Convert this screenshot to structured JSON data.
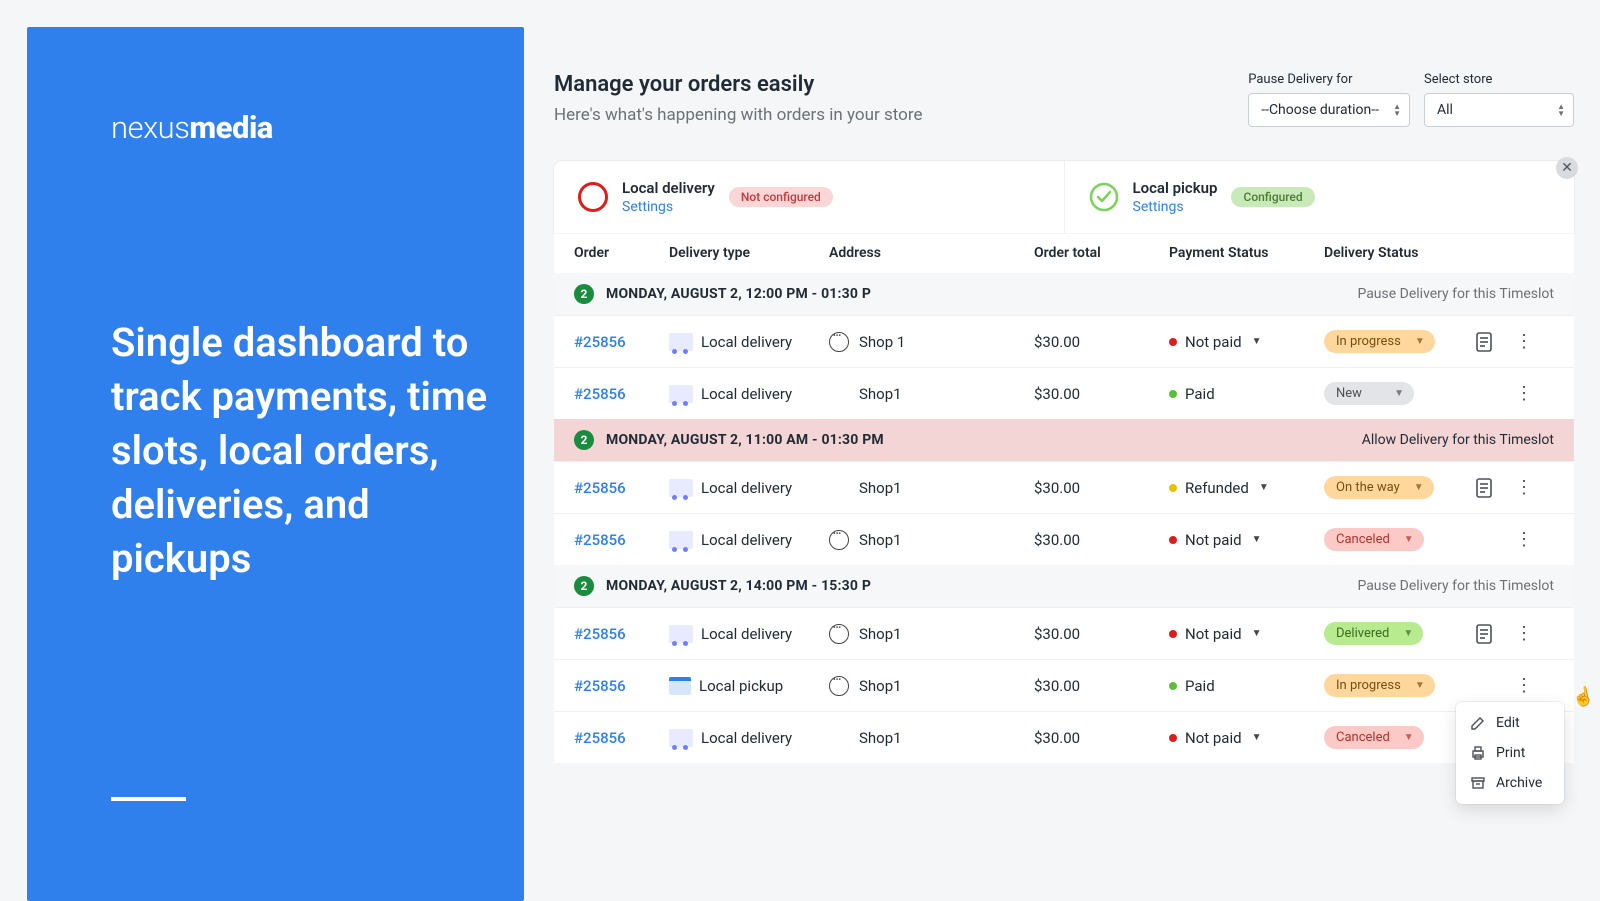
{
  "brand": {
    "light": "nexus",
    "bold": "media"
  },
  "headline": "Single dashboard to track payments, time slots, local orders, deliveries, and pickups",
  "header": {
    "title": "Manage your orders easily",
    "subtitle": "Here's what's happening with orders in your store"
  },
  "selects": {
    "pause_label": "Pause Delivery for",
    "pause_value": "--Choose duration--",
    "store_label": "Select store",
    "store_value": "All"
  },
  "config": {
    "delivery": {
      "title": "Local delivery",
      "link": "Settings",
      "badge": "Not configured"
    },
    "pickup": {
      "title": "Local pickup",
      "link": "Settings",
      "badge": "Configured"
    }
  },
  "columns": {
    "order": "Order",
    "delivery_type": "Delivery type",
    "address": "Address",
    "order_total": "Order total",
    "payment_status": "Payment Status",
    "delivery_status": "Delivery Status"
  },
  "popover": {
    "edit": "Edit",
    "print": "Print",
    "archive": "Archive"
  },
  "groups": [
    {
      "count": "2",
      "label": "MONDAY, AUGUST 2, 12:00 PM - 01:30 P",
      "action": "Pause Delivery for this Timeslot",
      "paused": false,
      "rows": [
        {
          "order": "#25856",
          "type": "Local delivery",
          "type_icon": "truck",
          "address": "Shop 1",
          "bubble": true,
          "total": "$30.00",
          "pay": "Not paid",
          "pay_dot": "red",
          "pay_caret": true,
          "status": "In progress",
          "status_class": "pill-yellow",
          "doc": true
        },
        {
          "order": "#25856",
          "type": "Local delivery",
          "type_icon": "truck",
          "address": "Shop1",
          "bubble": false,
          "total": "$30.00",
          "pay": "Paid",
          "pay_dot": "green",
          "pay_caret": false,
          "status": "New",
          "status_class": "pill-gray",
          "doc": false
        }
      ]
    },
    {
      "count": "2",
      "label": "MONDAY, AUGUST 2, 11:00 AM - 01:30 PM",
      "action": "Allow Delivery for this Timeslot",
      "paused": true,
      "rows": [
        {
          "order": "#25856",
          "type": "Local delivery",
          "type_icon": "truck",
          "address": "Shop1",
          "bubble": false,
          "total": "$30.00",
          "pay": "Refunded",
          "pay_dot": "yellow",
          "pay_caret": true,
          "status": "On the way",
          "status_class": "pill-yellow",
          "doc": true
        },
        {
          "order": "#25856",
          "type": "Local delivery",
          "type_icon": "truck",
          "address": "Shop1",
          "bubble": true,
          "total": "$30.00",
          "pay": "Not paid",
          "pay_dot": "red",
          "pay_caret": true,
          "status": "Canceled",
          "status_class": "pill-rose",
          "doc": false
        }
      ]
    },
    {
      "count": "2",
      "label": "MONDAY, AUGUST 2, 14:00 PM - 15:30 P",
      "action": "Pause Delivery for this Timeslot",
      "paused": false,
      "rows": [
        {
          "order": "#25856",
          "type": "Local delivery",
          "type_icon": "truck",
          "address": "Shop1",
          "bubble": true,
          "total": "$30.00",
          "pay": "Not paid",
          "pay_dot": "red",
          "pay_caret": true,
          "status": "Delivered",
          "status_class": "pill-lime",
          "doc": true
        },
        {
          "order": "#25856",
          "type": "Local pickup",
          "type_icon": "store",
          "address": "Shop1",
          "bubble": true,
          "total": "$30.00",
          "pay": "Paid",
          "pay_dot": "green",
          "pay_caret": false,
          "status": "In progress",
          "status_class": "pill-yellow",
          "doc": false
        },
        {
          "order": "#25856",
          "type": "Local delivery",
          "type_icon": "truck",
          "address": "Shop1",
          "bubble": false,
          "total": "$30.00",
          "pay": "Not paid",
          "pay_dot": "red",
          "pay_caret": true,
          "status": "Canceled",
          "status_class": "pill-rose",
          "doc": true
        }
      ]
    }
  ]
}
